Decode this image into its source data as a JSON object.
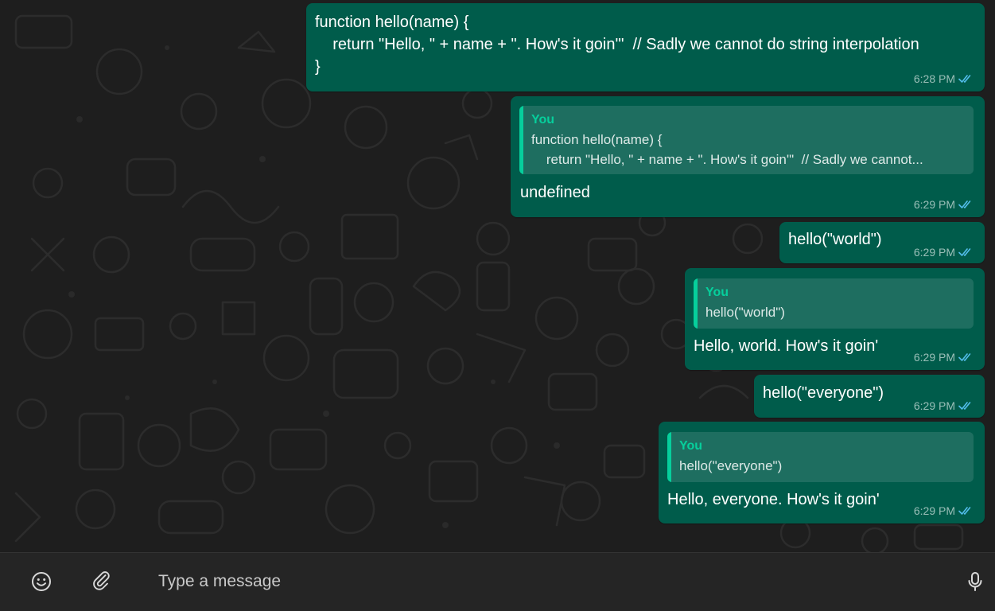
{
  "chat": {
    "messages": [
      {
        "text": "function hello(name) {\n    return \"Hello, \" + name + \". How's it goin'\"  // Sadly we cannot do string interpolation\n}",
        "time": "6:28 PM",
        "status": "read",
        "ticks_icon": "double-check-icon"
      },
      {
        "quote": {
          "author": "You",
          "text": "function hello(name) {\n    return \"Hello, \" + name + \". How's it goin'\"  // Sadly we cannot..."
        },
        "text": "undefined",
        "time": "6:29 PM",
        "status": "read"
      },
      {
        "text": "hello(\"world\")",
        "time": "6:29 PM",
        "status": "read"
      },
      {
        "quote": {
          "author": "You",
          "text": "hello(\"world\")"
        },
        "text": "Hello, world. How's it goin'",
        "time": "6:29 PM",
        "status": "read"
      },
      {
        "text": "hello(\"everyone\")",
        "time": "6:29 PM",
        "status": "read"
      },
      {
        "quote": {
          "author": "You",
          "text": "hello(\"everyone\")"
        },
        "text": "Hello, everyone. How's it goin'",
        "time": "6:29 PM",
        "status": "read"
      }
    ]
  },
  "compose": {
    "placeholder": "Type a message",
    "emoji_icon": "emoji-icon",
    "attach_icon": "paperclip-icon",
    "mic_icon": "microphone-icon"
  },
  "colors": {
    "bubble_outgoing": "#005c4b",
    "quote_background": "#1e6e60",
    "quote_accent": "#06cf9c",
    "read_ticks": "#53bdeb",
    "chat_background": "#1e1e1e",
    "compose_background": "#252525"
  }
}
